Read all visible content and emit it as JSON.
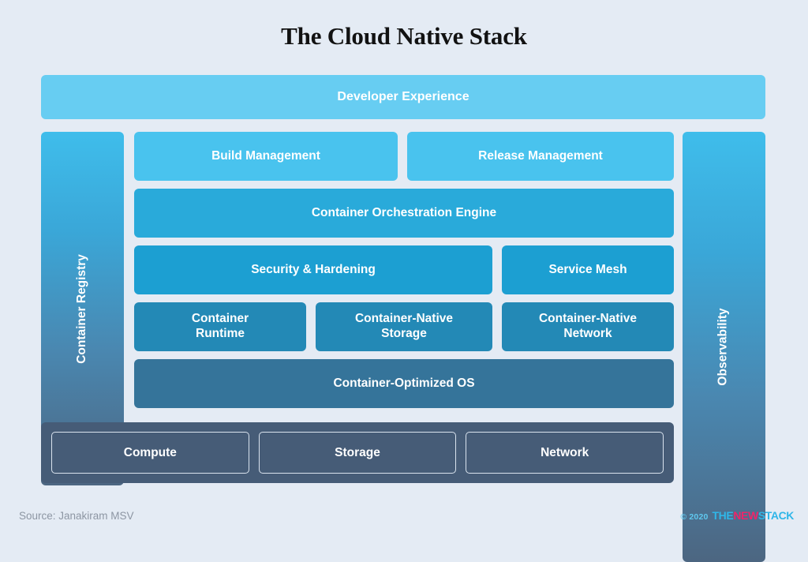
{
  "title": "The Cloud Native Stack",
  "background_color": "#e4ebf4",
  "diagram": {
    "developer_experience": {
      "label": "Developer Experience",
      "color": "#67cdf2"
    },
    "left_rail": {
      "label": "Container Registry",
      "gradient_from": "#3fbdeb",
      "gradient_to": "#4c6681"
    },
    "right_rail": {
      "label": "Observability",
      "gradient_from": "#3fbdeb",
      "gradient_to": "#4c6681"
    },
    "rows": [
      {
        "name": "management",
        "blocks": [
          {
            "label": "Build Management",
            "color": "#49c3ee"
          },
          {
            "label": "Release Management",
            "color": "#49c3ee"
          }
        ]
      },
      {
        "name": "orchestration",
        "blocks": [
          {
            "label": "Container Orchestration Engine",
            "color": "#29aada"
          }
        ]
      },
      {
        "name": "security-mesh",
        "blocks": [
          {
            "label": "Security & Hardening",
            "color": "#1c9fd2"
          },
          {
            "label": "Service Mesh",
            "color": "#1c9fd2"
          }
        ]
      },
      {
        "name": "runtime",
        "blocks": [
          {
            "label": "Container\nRuntime",
            "color": "#2389b6"
          },
          {
            "label": "Container-Native\nStorage",
            "color": "#2389b6"
          },
          {
            "label": "Container-Native\nNetwork",
            "color": "#2389b6"
          }
        ]
      },
      {
        "name": "os",
        "blocks": [
          {
            "label": "Container-Optimized OS",
            "color": "#35749a"
          }
        ]
      }
    ],
    "infrastructure": {
      "color": "#465c77",
      "boxes": [
        {
          "label": "Compute"
        },
        {
          "label": "Storage"
        },
        {
          "label": "Network"
        }
      ]
    }
  },
  "footer": {
    "source": "Source: Janakiram MSV",
    "copyright": "© 2020",
    "brand_the": "THE",
    "brand_new": "NEW",
    "brand_stack": "STACK",
    "brand_blue": "#2fb6e8",
    "brand_pink": "#f0246a"
  }
}
